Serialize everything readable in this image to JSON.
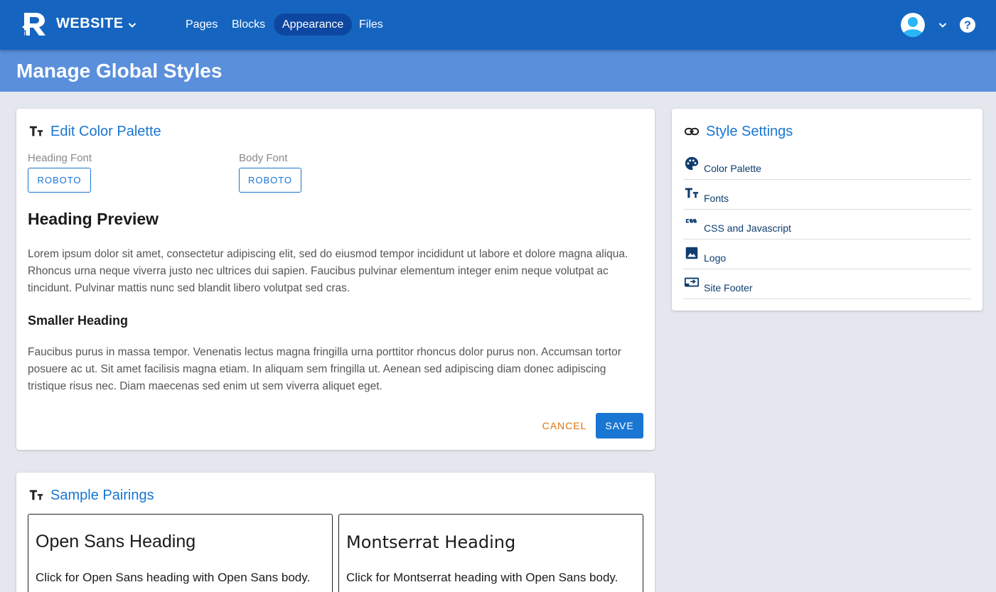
{
  "header": {
    "site_name": "WEBSITE",
    "nav": [
      {
        "label": "Pages"
      },
      {
        "label": "Blocks"
      },
      {
        "label": "Appearance",
        "active": true
      },
      {
        "label": "Files"
      }
    ]
  },
  "page_title": "Manage Global Styles",
  "palette_card": {
    "title": "Edit Color Palette",
    "heading_font_label": "Heading Font",
    "heading_font_value": "ROBOTO",
    "body_font_label": "Body Font",
    "body_font_value": "ROBOTO",
    "heading_preview": "Heading Preview",
    "paragraph1": "Lorem ipsum dolor sit amet, consectetur adipiscing elit, sed do eiusmod tempor incididunt ut labore et dolore magna aliqua. Rhoncus urna neque viverra justo nec ultrices dui sapien. Faucibus pulvinar elementum integer enim neque volutpat ac tincidunt. Pulvinar mattis nunc sed blandit libero volutpat sed cras.",
    "smaller_heading": "Smaller Heading",
    "paragraph2": "Faucibus purus in massa tempor. Venenatis lectus magna fringilla urna porttitor rhoncus dolor purus non. Accumsan tortor posuere ac ut. Sit amet facilisis magna etiam. In aliquam sem fringilla ut. Aenean sed adipiscing diam donec adipiscing tristique risus nec. Diam maecenas sed enim ut sem viverra aliquet eget.",
    "cancel_label": "CANCEL",
    "save_label": "SAVE"
  },
  "settings_card": {
    "title": "Style Settings",
    "items": [
      {
        "label": "Color Palette",
        "icon": "palette-icon"
      },
      {
        "label": "Fonts",
        "icon": "text-fields-icon"
      },
      {
        "label": "CSS and Javascript",
        "icon": "css-icon"
      },
      {
        "label": "Logo",
        "icon": "image-icon"
      },
      {
        "label": "Site Footer",
        "icon": "footer-icon"
      }
    ]
  },
  "pairings_card": {
    "title": "Sample Pairings",
    "pairings": [
      {
        "heading": "Open Sans Heading",
        "body": "Click for Open Sans heading with Open Sans body."
      },
      {
        "heading": "Montserrat Heading",
        "body": "Click for Montserrat heading with Open Sans body."
      }
    ]
  },
  "colors": {
    "header_bg": "#1565c0",
    "title_bar_bg": "#5a8fdb",
    "accent": "#1976d2",
    "cancel": "#e0740c"
  }
}
